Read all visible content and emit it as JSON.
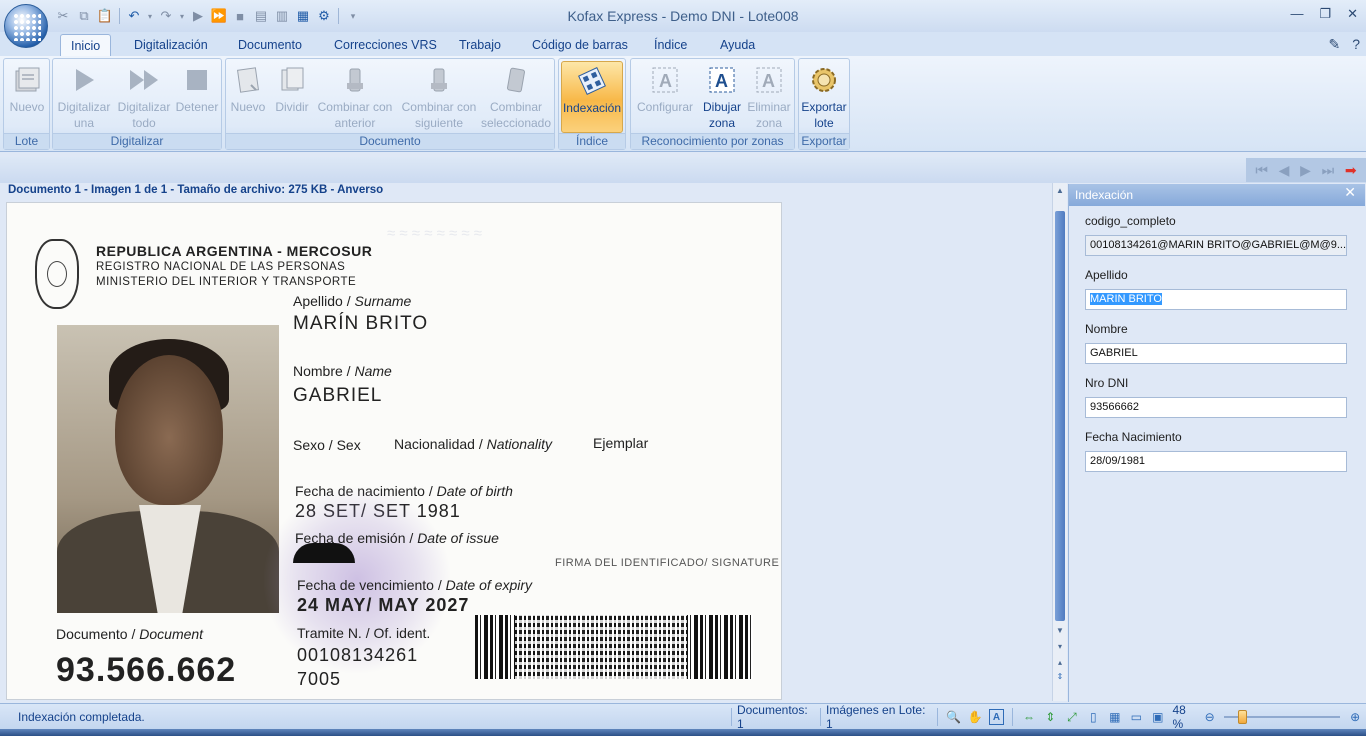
{
  "window": {
    "title": "Kofax Express - Demo DNI - Lote008"
  },
  "tabs": [
    {
      "label": "Inicio",
      "active": true
    },
    {
      "label": "Digitalización"
    },
    {
      "label": "Documento"
    },
    {
      "label": "Correcciones VRS"
    },
    {
      "label": "Trabajo"
    },
    {
      "label": "Código de barras"
    },
    {
      "label": "Índice"
    },
    {
      "label": "Ayuda"
    }
  ],
  "ribbon": {
    "groups": {
      "lote": {
        "label": "Lote",
        "buttons": [
          {
            "line1": "Nuevo",
            "line2": ""
          }
        ]
      },
      "digitalizar": {
        "label": "Digitalizar",
        "buttons": [
          {
            "line1": "Digitalizar",
            "line2": "una"
          },
          {
            "line1": "Digitalizar",
            "line2": "todo"
          },
          {
            "line1": "Detener",
            "line2": ""
          }
        ]
      },
      "documento": {
        "label": "Documento",
        "buttons": [
          {
            "line1": "Nuevo",
            "line2": ""
          },
          {
            "line1": "Dividir",
            "line2": ""
          },
          {
            "line1": "Combinar con",
            "line2": "anterior"
          },
          {
            "line1": "Combinar con",
            "line2": "siguiente"
          },
          {
            "line1": "Combinar",
            "line2": "seleccionado"
          }
        ]
      },
      "indice": {
        "label": "Índice",
        "buttons": [
          {
            "line1": "Indexación",
            "line2": ""
          }
        ]
      },
      "zonas": {
        "label": "Reconocimiento por zonas",
        "buttons": [
          {
            "line1": "Configurar",
            "line2": ""
          },
          {
            "line1": "Dibujar",
            "line2": "zona"
          },
          {
            "line1": "Eliminar",
            "line2": "zona"
          }
        ]
      },
      "exportar": {
        "label": "Exportar",
        "buttons": [
          {
            "line1": "Exportar",
            "line2": "lote"
          }
        ]
      }
    }
  },
  "doc_info": "Documento 1 - Imagen 1 de 1 - Tamaño de archivo: 275 KB - Anverso",
  "dni": {
    "header1": "REPUBLICA ARGENTINA - MERCOSUR",
    "header2": "REGISTRO NACIONAL DE LAS PERSONAS",
    "header3": "MINISTERIO DEL INTERIOR Y TRANSPORTE",
    "surname_label": "Apellido",
    "surname_label_en": "Surname",
    "surname": "MARÍN BRITO",
    "name_label": "Nombre",
    "name_label_en": "Name",
    "name": "GABRIEL",
    "sex_label": "Sexo / Sex",
    "nationality_label": "Nacionalidad",
    "nationality_label_en": "Nationality",
    "copy_label": "Ejemplar",
    "birth_label": "Fecha de nacimiento",
    "birth_label_en": "Date of birth",
    "birth": "28 SET/ SET 1981",
    "issue_label": "Fecha de emisión",
    "issue_label_en": "Date of issue",
    "signature_label": "FIRMA DEL IDENTIFICADO/ SIGNATURE",
    "expiry_label": "Fecha de vencimiento",
    "expiry_label_en": "Date of expiry",
    "expiry": "24 MAY/ MAY 2027",
    "tramite_label": "Tramite N. / Of. ident.",
    "tramite": "00108134261",
    "tramite2": "7005",
    "document_label": "Documento",
    "document_label_en": "Document",
    "document_number": "93.566.662"
  },
  "index_panel": {
    "title": "Indexación",
    "fields": [
      {
        "label": "codigo_completo",
        "value": "00108134261@MARIN BRITO@GABRIEL@M@9..."
      },
      {
        "label": "Apellido",
        "value": "MARIN BRITO"
      },
      {
        "label": "Nombre",
        "value": "GABRIEL"
      },
      {
        "label": "Nro DNI",
        "value": "93566662"
      },
      {
        "label": "Fecha Nacimiento",
        "value": "28/09/1981"
      }
    ]
  },
  "statusbar": {
    "message": "Indexación completada.",
    "documents": "Documentos: 1",
    "images": "Imágenes en Lote: 1",
    "zoom": "48 %"
  }
}
